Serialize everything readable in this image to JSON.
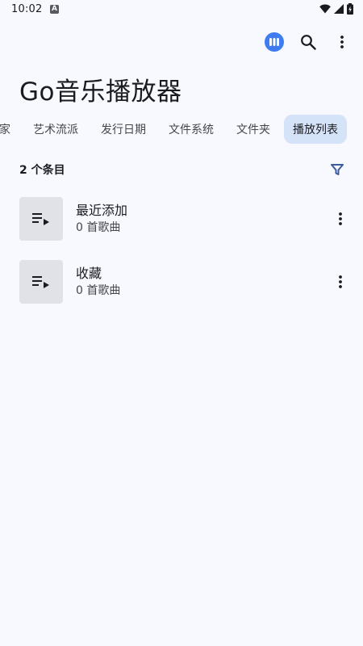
{
  "status_bar": {
    "time": "10:02",
    "a_badge": "A",
    "icons": [
      "wifi-icon",
      "signal-icon",
      "battery-charging-icon"
    ]
  },
  "top_bar": {
    "actions": [
      "equalizer-icon",
      "search-icon",
      "more-vert-icon"
    ],
    "accent_color": "#3f7cf2"
  },
  "app": {
    "title": "Go音乐播放器"
  },
  "tabs": [
    {
      "label": "家",
      "active": false
    },
    {
      "label": "艺术流派",
      "active": false
    },
    {
      "label": "发行日期",
      "active": false
    },
    {
      "label": "文件系统",
      "active": false
    },
    {
      "label": "文件夹",
      "active": false
    },
    {
      "label": "播放列表",
      "active": true
    }
  ],
  "list_header": {
    "count_text": "2 个条目",
    "filter_icon": "filter-icon",
    "filter_color": "#3a5ba0"
  },
  "playlists": [
    {
      "title": "最近添加",
      "subtitle": "0 首歌曲",
      "icon": "playlist-play-icon"
    },
    {
      "title": "收藏",
      "subtitle": "0 首歌曲",
      "icon": "playlist-play-icon"
    }
  ]
}
